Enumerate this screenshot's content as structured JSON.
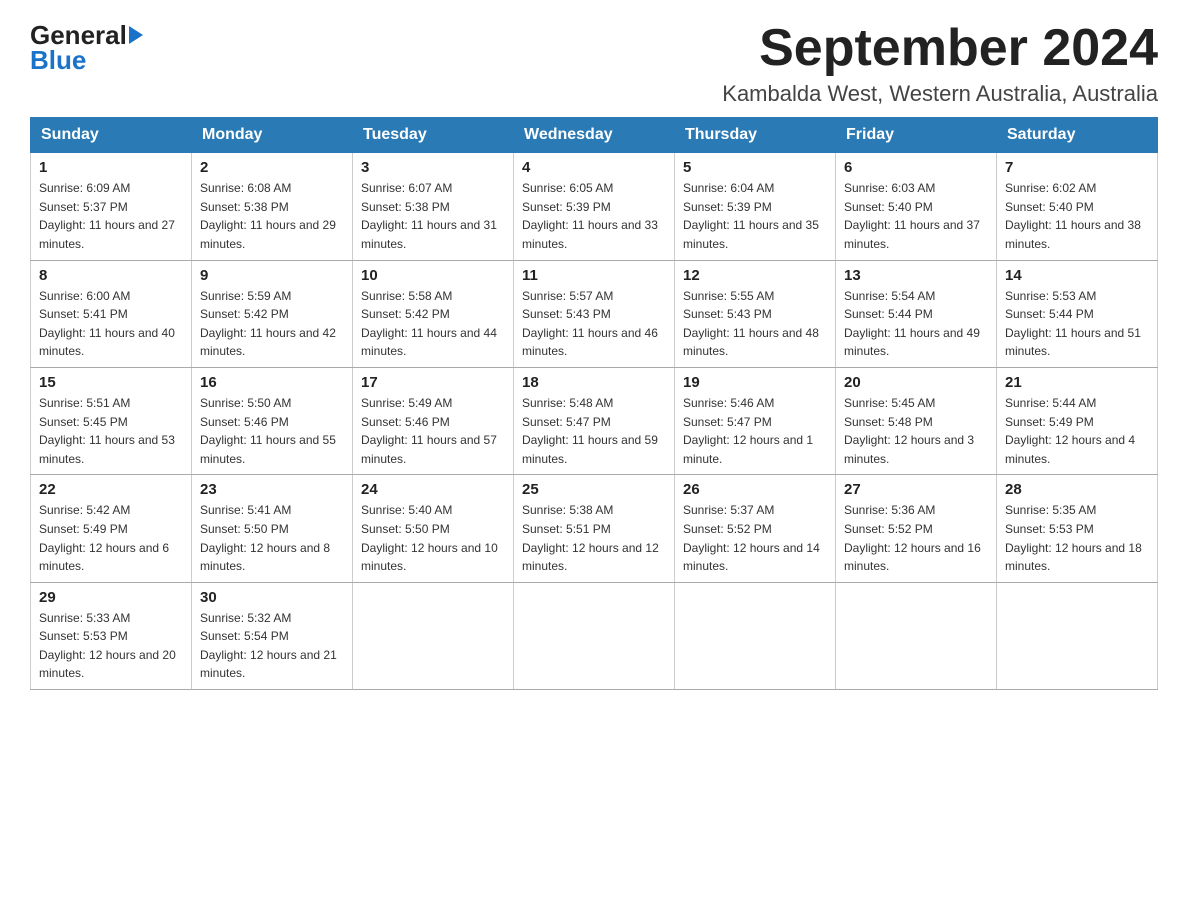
{
  "logo": {
    "general": "General",
    "arrow": "▶",
    "blue": "Blue"
  },
  "header": {
    "month_year": "September 2024",
    "location": "Kambalda West, Western Australia, Australia"
  },
  "weekdays": [
    "Sunday",
    "Monday",
    "Tuesday",
    "Wednesday",
    "Thursday",
    "Friday",
    "Saturday"
  ],
  "weeks": [
    [
      {
        "day": "1",
        "sunrise": "6:09 AM",
        "sunset": "5:37 PM",
        "daylight": "11 hours and 27 minutes."
      },
      {
        "day": "2",
        "sunrise": "6:08 AM",
        "sunset": "5:38 PM",
        "daylight": "11 hours and 29 minutes."
      },
      {
        "day": "3",
        "sunrise": "6:07 AM",
        "sunset": "5:38 PM",
        "daylight": "11 hours and 31 minutes."
      },
      {
        "day": "4",
        "sunrise": "6:05 AM",
        "sunset": "5:39 PM",
        "daylight": "11 hours and 33 minutes."
      },
      {
        "day": "5",
        "sunrise": "6:04 AM",
        "sunset": "5:39 PM",
        "daylight": "11 hours and 35 minutes."
      },
      {
        "day": "6",
        "sunrise": "6:03 AM",
        "sunset": "5:40 PM",
        "daylight": "11 hours and 37 minutes."
      },
      {
        "day": "7",
        "sunrise": "6:02 AM",
        "sunset": "5:40 PM",
        "daylight": "11 hours and 38 minutes."
      }
    ],
    [
      {
        "day": "8",
        "sunrise": "6:00 AM",
        "sunset": "5:41 PM",
        "daylight": "11 hours and 40 minutes."
      },
      {
        "day": "9",
        "sunrise": "5:59 AM",
        "sunset": "5:42 PM",
        "daylight": "11 hours and 42 minutes."
      },
      {
        "day": "10",
        "sunrise": "5:58 AM",
        "sunset": "5:42 PM",
        "daylight": "11 hours and 44 minutes."
      },
      {
        "day": "11",
        "sunrise": "5:57 AM",
        "sunset": "5:43 PM",
        "daylight": "11 hours and 46 minutes."
      },
      {
        "day": "12",
        "sunrise": "5:55 AM",
        "sunset": "5:43 PM",
        "daylight": "11 hours and 48 minutes."
      },
      {
        "day": "13",
        "sunrise": "5:54 AM",
        "sunset": "5:44 PM",
        "daylight": "11 hours and 49 minutes."
      },
      {
        "day": "14",
        "sunrise": "5:53 AM",
        "sunset": "5:44 PM",
        "daylight": "11 hours and 51 minutes."
      }
    ],
    [
      {
        "day": "15",
        "sunrise": "5:51 AM",
        "sunset": "5:45 PM",
        "daylight": "11 hours and 53 minutes."
      },
      {
        "day": "16",
        "sunrise": "5:50 AM",
        "sunset": "5:46 PM",
        "daylight": "11 hours and 55 minutes."
      },
      {
        "day": "17",
        "sunrise": "5:49 AM",
        "sunset": "5:46 PM",
        "daylight": "11 hours and 57 minutes."
      },
      {
        "day": "18",
        "sunrise": "5:48 AM",
        "sunset": "5:47 PM",
        "daylight": "11 hours and 59 minutes."
      },
      {
        "day": "19",
        "sunrise": "5:46 AM",
        "sunset": "5:47 PM",
        "daylight": "12 hours and 1 minute."
      },
      {
        "day": "20",
        "sunrise": "5:45 AM",
        "sunset": "5:48 PM",
        "daylight": "12 hours and 3 minutes."
      },
      {
        "day": "21",
        "sunrise": "5:44 AM",
        "sunset": "5:49 PM",
        "daylight": "12 hours and 4 minutes."
      }
    ],
    [
      {
        "day": "22",
        "sunrise": "5:42 AM",
        "sunset": "5:49 PM",
        "daylight": "12 hours and 6 minutes."
      },
      {
        "day": "23",
        "sunrise": "5:41 AM",
        "sunset": "5:50 PM",
        "daylight": "12 hours and 8 minutes."
      },
      {
        "day": "24",
        "sunrise": "5:40 AM",
        "sunset": "5:50 PM",
        "daylight": "12 hours and 10 minutes."
      },
      {
        "day": "25",
        "sunrise": "5:38 AM",
        "sunset": "5:51 PM",
        "daylight": "12 hours and 12 minutes."
      },
      {
        "day": "26",
        "sunrise": "5:37 AM",
        "sunset": "5:52 PM",
        "daylight": "12 hours and 14 minutes."
      },
      {
        "day": "27",
        "sunrise": "5:36 AM",
        "sunset": "5:52 PM",
        "daylight": "12 hours and 16 minutes."
      },
      {
        "day": "28",
        "sunrise": "5:35 AM",
        "sunset": "5:53 PM",
        "daylight": "12 hours and 18 minutes."
      }
    ],
    [
      {
        "day": "29",
        "sunrise": "5:33 AM",
        "sunset": "5:53 PM",
        "daylight": "12 hours and 20 minutes."
      },
      {
        "day": "30",
        "sunrise": "5:32 AM",
        "sunset": "5:54 PM",
        "daylight": "12 hours and 21 minutes."
      },
      null,
      null,
      null,
      null,
      null
    ]
  ],
  "labels": {
    "sunrise": "Sunrise:",
    "sunset": "Sunset:",
    "daylight": "Daylight:"
  }
}
